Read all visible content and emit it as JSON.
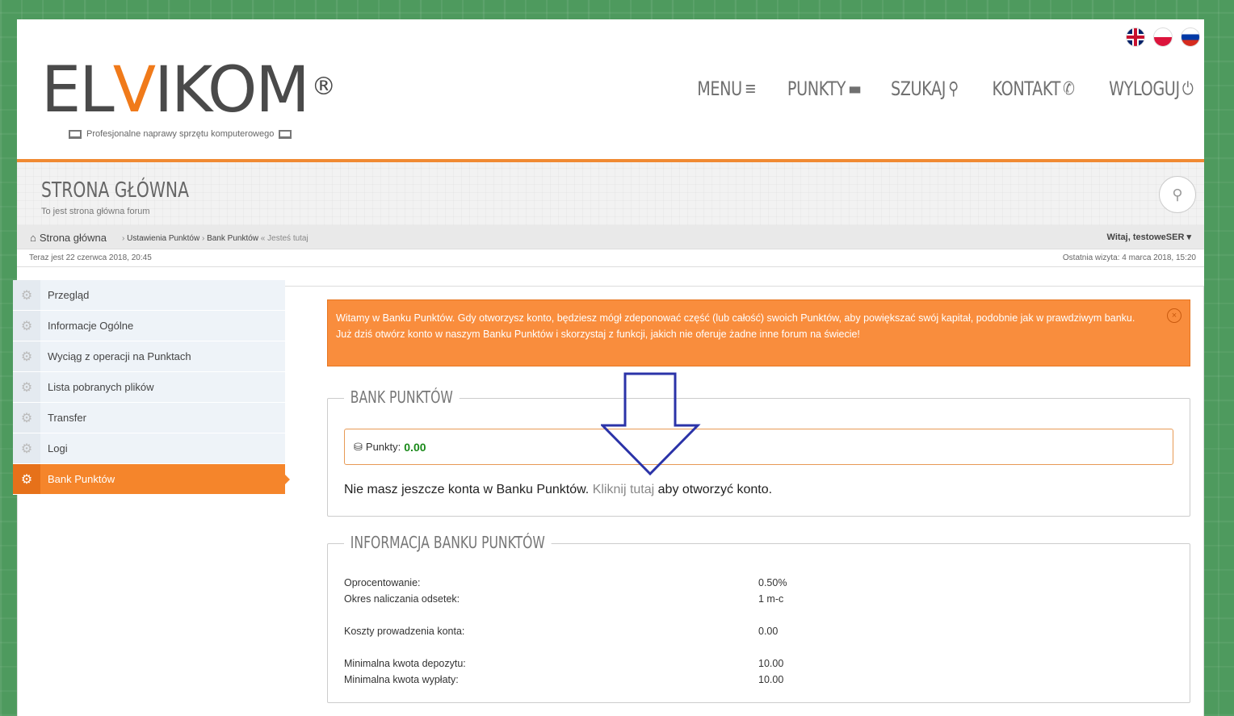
{
  "flags": [
    {
      "name": "english",
      "icon": "uk-flag-icon"
    },
    {
      "name": "polish",
      "icon": "pl-flag-icon"
    },
    {
      "name": "russian",
      "icon": "ru-flag-icon"
    }
  ],
  "logo": {
    "part1": "ЕL",
    "part2": "V",
    "part3": "IKOM",
    "reg": "®",
    "tagline": "Profesjonalne naprawy sprzętu komputerowego"
  },
  "nav": [
    {
      "label": "MENU",
      "icon": "≡"
    },
    {
      "label": "PUNKTY",
      "icon": "▬"
    },
    {
      "label": "SZUKAJ",
      "icon": "⚲"
    },
    {
      "label": "KONTAKT",
      "icon": "✆"
    },
    {
      "label": "WYLOGUJ",
      "icon": "⏻"
    }
  ],
  "banner": {
    "title": "STRONA GŁÓWNA",
    "subtitle": "To jest strona główna forum"
  },
  "breadcrumb": {
    "home": "Strona główna",
    "sep": "›",
    "item1": "Ustawienia Punktów",
    "item2": "Bank Punktów",
    "here": "« Jesteś tutaj"
  },
  "welcome": "Witaj, testoweSER ▾",
  "timebar": {
    "now": "Teraz jest 22 czerwca 2018, 20:45",
    "last": "Ostatnia wizyta: 4 marca 2018, 15:20"
  },
  "sidebar": {
    "items": [
      {
        "label": "Przegląd"
      },
      {
        "label": "Informacje Ogólne"
      },
      {
        "label": "Wyciąg z operacji na Punktach"
      },
      {
        "label": "Lista pobranych plików"
      },
      {
        "label": "Transfer"
      },
      {
        "label": "Logi"
      },
      {
        "label": "Bank Punktów"
      }
    ]
  },
  "alert": {
    "text": "Witamy w Banku Punktów. Gdy otworzysz konto, będziesz mógł zdeponować część (lub całość) swoich Punktów, aby powiększać swój kapitał, podobnie jak w prawdziwym banku. Już dziś otwórz konto w naszym Banku Punktów i skorzystaj z funkcji, jakich nie oferuje żadne inne forum na świecie!",
    "close": "×"
  },
  "bank": {
    "legend": "BANK PUNKTÓW",
    "points_label": "Punkty:",
    "points_value": "0.00",
    "no_account_pre": "Nie masz jeszcze konta w Banku Punktów.",
    "link": "Kliknij tutaj",
    "no_account_post": "aby otworzyć konto."
  },
  "info": {
    "legend": "INFORMACJA BANKU PUNKTÓW",
    "rows": [
      {
        "label": "Oprocentowanie:",
        "value": "0.50%"
      },
      {
        "label": "Okres naliczania odsetek:",
        "value": "1 m-c"
      },
      {
        "label": "Koszty prowadzenia konta:",
        "value": "0.00"
      },
      {
        "label": "Minimalna kwota depozytu:",
        "value": "10.00"
      },
      {
        "label": "Minimalna kwota wypłaty:",
        "value": "10.00"
      }
    ]
  },
  "colors": {
    "accent": "#f5852b",
    "arrow": "#2b33a8"
  }
}
